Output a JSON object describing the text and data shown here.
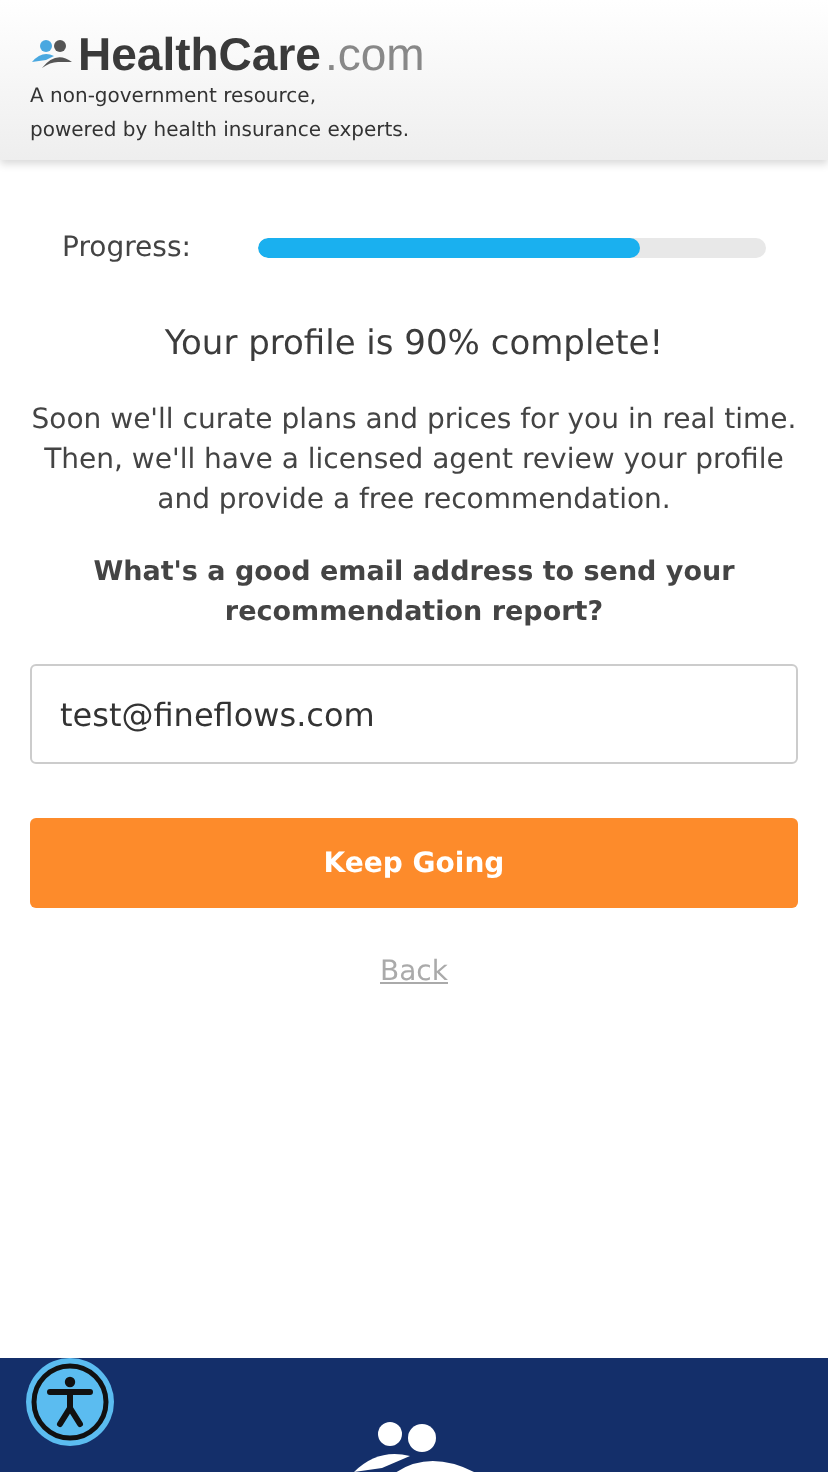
{
  "header": {
    "brand_name": "HealthCare",
    "brand_suffix": ".com",
    "tagline": [
      "A non-government resource,",
      "powered by health insurance experts."
    ]
  },
  "progress": {
    "label": "Progress:",
    "level": 0.75
  },
  "heading": "Your profile is 90% complete!",
  "intro": "Soon we'll curate plans and prices for you in real time. Then, we'll have a licensed agent review your profile and provide a free recommendation.",
  "question": "What's a good email address to send your recommendation report?",
  "email_field": {
    "value": "test@fineflows.com"
  },
  "primary_button": "Keep Going",
  "back_link": "Back"
}
